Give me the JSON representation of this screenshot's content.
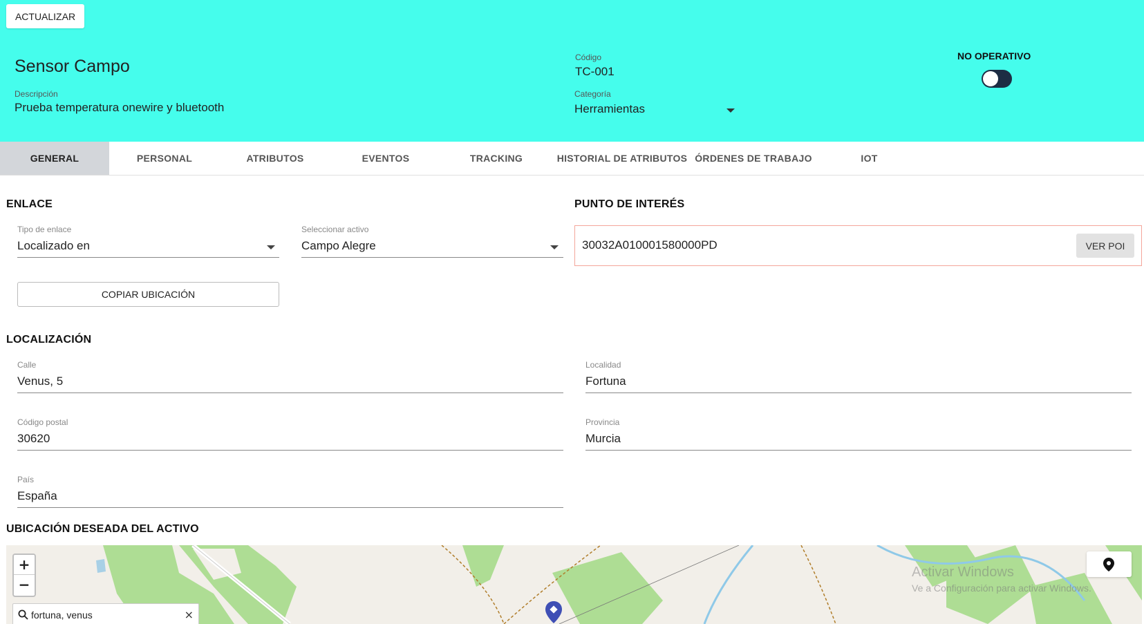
{
  "header": {
    "update_button": "ACTUALIZAR",
    "asset_name": "Sensor Campo",
    "description_label": "Descripción",
    "description_value": "Prueba temperatura onewire y bluetooth",
    "code_label": "Código",
    "code_value": "TC-001",
    "category_label": "Categoría",
    "category_value": "Herramientas",
    "status_label": "NO OPERATIVO",
    "status_on": false,
    "bg_color": "#45fdec"
  },
  "tabs": [
    {
      "label": "GENERAL",
      "active": true
    },
    {
      "label": "PERSONAL",
      "active": false
    },
    {
      "label": "ATRIBUTOS",
      "active": false
    },
    {
      "label": "EVENTOS",
      "active": false
    },
    {
      "label": "TRACKING",
      "active": false
    },
    {
      "label": "HISTORIAL DE ATRIBUTOS",
      "active": false
    },
    {
      "label": "ÓRDENES DE TRABAJO",
      "active": false
    },
    {
      "label": "IOT",
      "active": false
    }
  ],
  "enlace": {
    "title": "ENLACE",
    "link_type_label": "Tipo de enlace",
    "link_type_value": "Localizado en",
    "asset_select_label": "Seleccionar activo",
    "asset_select_value": "Campo Alegre",
    "copy_button": "COPIAR UBICACIÓN"
  },
  "poi": {
    "title": "PUNTO DE INTERÉS",
    "value": "30032A010001580000PD",
    "button": "VER POI"
  },
  "localizacion": {
    "title": "LOCALIZACIÓN",
    "street_label": "Calle",
    "street_value": "Venus, 5",
    "locality_label": "Localidad",
    "locality_value": "Fortuna",
    "postal_label": "Código postal",
    "postal_value": "30620",
    "province_label": "Provincia",
    "province_value": "Murcia",
    "country_label": "País",
    "country_value": "España"
  },
  "map": {
    "title": "UBICACIÓN DESEADA DEL ACTIVO",
    "zoom_in": "+",
    "zoom_out": "−",
    "search_value": "fortuna, venus",
    "clear": "×",
    "watermark_line1": "Activar Windows",
    "watermark_line2": "Ve a Configuración para activar Windows.",
    "marker_color": "#3f4fb5",
    "field_color": "#aedd94"
  }
}
